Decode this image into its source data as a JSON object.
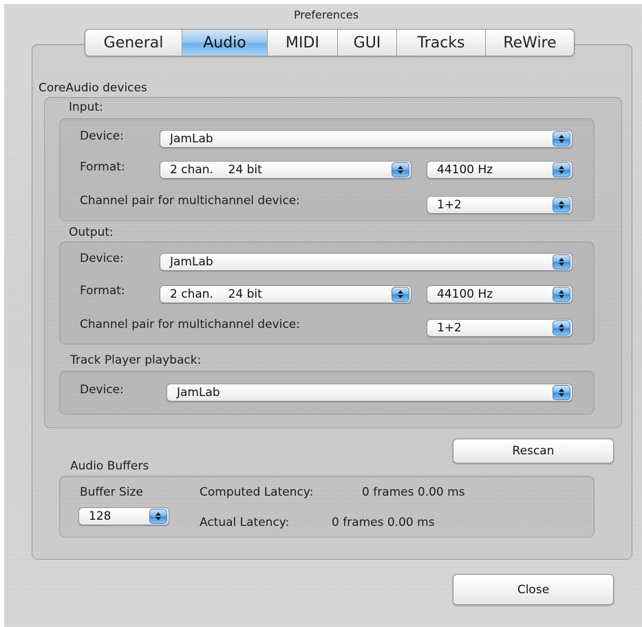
{
  "window": {
    "title": "Preferences"
  },
  "tabs": [
    {
      "label": "General",
      "active": false
    },
    {
      "label": "Audio",
      "active": true
    },
    {
      "label": "MIDI",
      "active": false
    },
    {
      "label": "GUI",
      "active": false
    },
    {
      "label": "Tracks",
      "active": false
    },
    {
      "label": "ReWire",
      "active": false
    }
  ],
  "coreaudio": {
    "heading": "CoreAudio devices",
    "input": {
      "heading": "Input:",
      "device_label": "Device:",
      "device_value": "JamLab",
      "format_label": "Format:",
      "format_value": "2 chan.    24 bit",
      "rate_value": "44100 Hz",
      "channel_pair_label": "Channel pair for multichannel device:",
      "channel_pair_value": "1+2"
    },
    "output": {
      "heading": "Output:",
      "device_label": "Device:",
      "device_value": "JamLab",
      "format_label": "Format:",
      "format_value": "2 chan.    24 bit",
      "rate_value": "44100 Hz",
      "channel_pair_label": "Channel pair for multichannel device:",
      "channel_pair_value": "1+2"
    },
    "track_player": {
      "heading": "Track Player playback:",
      "device_label": "Device:",
      "device_value": "JamLab"
    }
  },
  "rescan_label": "Rescan",
  "buffers": {
    "heading": "Audio Buffers",
    "buffer_size_label": "Buffer Size",
    "buffer_size_value": "128",
    "computed_latency_label": "Computed Latency:",
    "computed_latency_value": "0 frames  0.00 ms",
    "actual_latency_label": "Actual Latency:",
    "actual_latency_value": "0 frames  0.00 ms"
  },
  "close_label": "Close",
  "icons": {
    "popup_arrow": "up-down-chevron-icon"
  },
  "colors": {
    "accent": "#6eafe6"
  }
}
